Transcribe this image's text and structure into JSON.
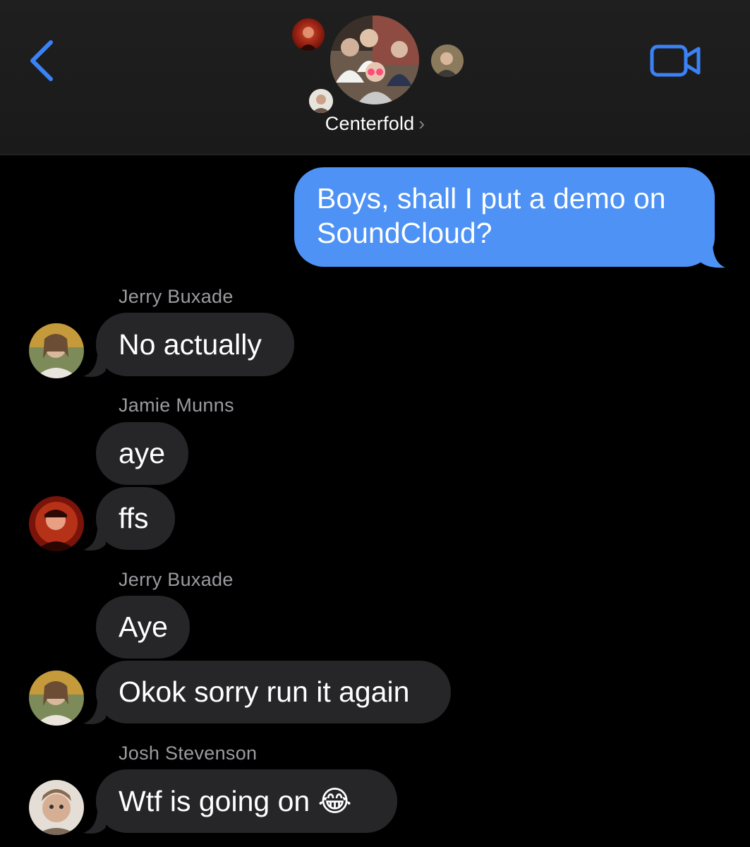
{
  "header": {
    "group_name": "Centerfold",
    "chevron": "›",
    "back_icon": "chevron-left-icon",
    "video_icon": "video-camera-icon",
    "accent_color": "#3b82f6"
  },
  "messages": [
    {
      "direction": "out",
      "text": "Boys, shall I put a demo on SoundCloud?"
    },
    {
      "sender": "Jerry Buxade"
    },
    {
      "direction": "in",
      "text": "No actually"
    },
    {
      "sender": "Jamie Munns"
    },
    {
      "direction": "in",
      "text": "aye"
    },
    {
      "direction": "in",
      "text": "ffs"
    },
    {
      "sender": "Jerry Buxade"
    },
    {
      "direction": "in",
      "text": "Aye"
    },
    {
      "direction": "in",
      "text": "Okok sorry run it again"
    },
    {
      "sender": "Josh Stevenson"
    },
    {
      "direction": "in",
      "text": "Wtf is going on 😂"
    }
  ],
  "colors": {
    "background": "#000000",
    "header_bg": "#1c1c1c",
    "incoming_bubble": "#262629",
    "outgoing_bubble": "#4e92f5",
    "sender_name": "#9b9ba0"
  }
}
